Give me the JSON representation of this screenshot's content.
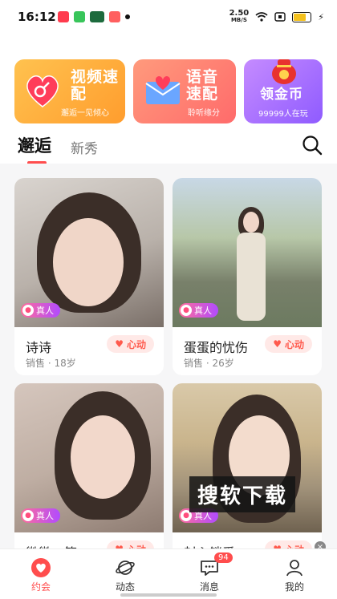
{
  "status": {
    "time": "16:12",
    "speed_top": "2.50",
    "speed_bottom": "MB/S"
  },
  "banners": [
    {
      "title": "视频速配",
      "subtitle": "邂逅一见倾心"
    },
    {
      "title": "语音速配",
      "subtitle": "聆听缘分"
    },
    {
      "title": "领金币",
      "subtitle": "99999人在玩"
    }
  ],
  "tabs": {
    "active": "邂逅",
    "other": "新秀"
  },
  "real_badge": "真人",
  "heart_label": "心动",
  "cards": [
    {
      "name": "诗诗",
      "meta": "销售 · 18岁"
    },
    {
      "name": "蛋蛋的忧伤",
      "meta": "销售 · 26岁"
    },
    {
      "name": "微微一笑",
      "meta": ""
    },
    {
      "name": "封心锁爱",
      "meta": ""
    }
  ],
  "overlay_text": "搜软下载",
  "nav": [
    {
      "label": "约会"
    },
    {
      "label": "动态"
    },
    {
      "label": "消息",
      "count": "94"
    },
    {
      "label": "我的"
    }
  ],
  "colors": {
    "accent": "#ff4d4d",
    "badge_start": "#ff6c9a",
    "badge_end": "#b14bff"
  }
}
